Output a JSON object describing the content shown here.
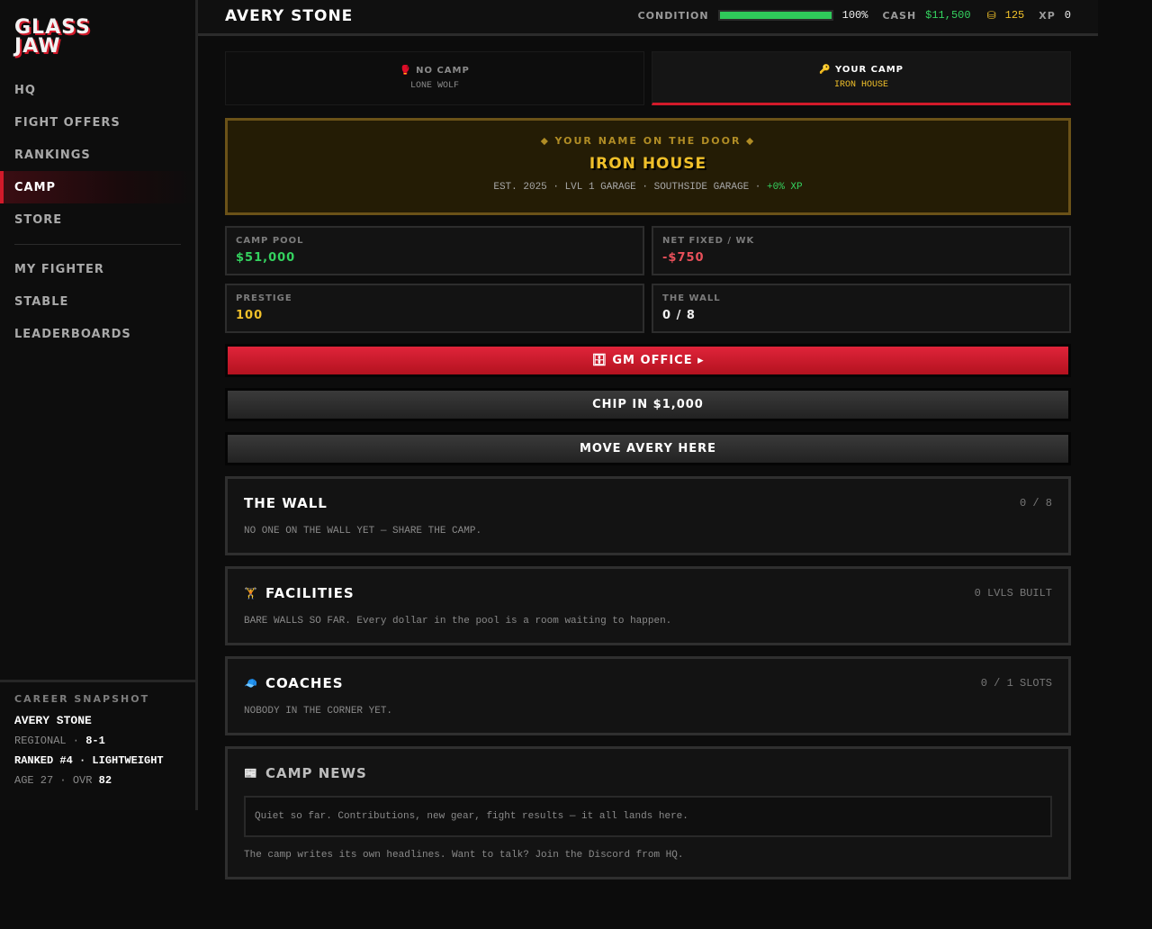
{
  "app": {
    "logo_line1": "GLASS",
    "logo_line2": "JAW"
  },
  "nav": {
    "items": [
      "HQ",
      "FIGHT OFFERS",
      "RANKINGS",
      "CAMP",
      "STORE"
    ],
    "items2": [
      "MY FIGHTER",
      "STABLE",
      "LEADERBOARDS"
    ],
    "active": "CAMP"
  },
  "snapshot": {
    "title": "CAREER SNAPSHOT",
    "name": "AVERY STONE",
    "region_label": "REGIONAL",
    "record": "8-1",
    "rank_line": "RANKED #4 · LIGHTWEIGHT",
    "age_label": "AGE 27",
    "ovr_label": "OVR",
    "ovr": "82"
  },
  "topbar": {
    "fighter_name": "AVERY STONE",
    "condition_label": "CONDITION",
    "condition_percent": 100,
    "condition_text": "100%",
    "cash_label": "CASH",
    "cash": "$11,500",
    "coins_icon": "coin-stack-icon",
    "coins": "125",
    "xp_label": "XP",
    "xp": "0"
  },
  "tabs": [
    {
      "title": "NO CAMP",
      "sub": "LONE WOLF",
      "icon": "boxing-glove-icon",
      "glyph": "🥊"
    },
    {
      "title": "YOUR CAMP",
      "sub": "IRON HOUSE",
      "icon": "key-icon",
      "glyph": "🔑"
    }
  ],
  "banner": {
    "kicker": "⬥ YOUR NAME ON THE DOOR ⬥",
    "title": "IRON HOUSE",
    "meta": "EST. 2025 · LVL 1 GARAGE · SOUTHSIDE GARAGE ·",
    "xp": "+0% XP"
  },
  "stats": {
    "pool_label": "CAMP POOL",
    "pool": "$51,000",
    "fixed_label": "NET FIXED / WK",
    "fixed": "-$750",
    "prestige_label": "PRESTIGE",
    "prestige": "100",
    "wall_label": "THE WALL",
    "wall": "0 / 8"
  },
  "buttons": {
    "gm_icon": "🗄",
    "gm": "GM OFFICE",
    "gm_arrow": "▸",
    "chip": "CHIP IN $1,000",
    "move": "MOVE AVERY HERE"
  },
  "panels": {
    "wall": {
      "title": "THE WALL",
      "count": "0 / 8",
      "body": "NO ONE ON THE WALL YET — SHARE THE CAMP."
    },
    "facilities": {
      "icon": "🏋",
      "title": "FACILITIES",
      "count": "0 LVLS BUILT",
      "body": "BARE WALLS SO FAR. Every dollar in the pool is a room waiting to happen."
    },
    "coaches": {
      "icon": "🧢",
      "title": "COACHES",
      "count": "0 / 1 SLOTS",
      "body": "NOBODY IN THE CORNER YET."
    },
    "news": {
      "icon": "📰",
      "title": "CAMP NEWS",
      "box": "Quiet so far. Contributions, new gear, fight results — it all lands here.",
      "foot": "The camp writes its own headlines. Want to talk? Join the Discord from HQ."
    }
  },
  "colors": {
    "accent": "#d11a2a",
    "gold": "#f0c02a",
    "green": "#34d25f",
    "negative": "#e8505a"
  }
}
